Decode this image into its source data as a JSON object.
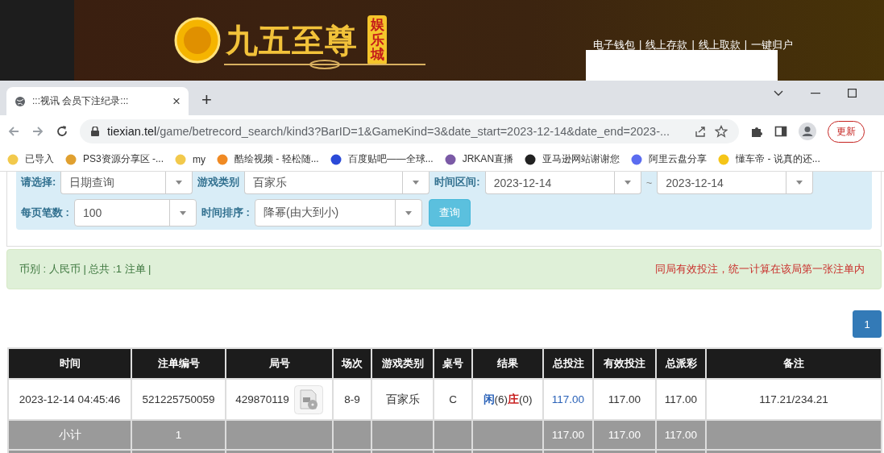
{
  "site_header": {
    "logo_text": "九五至尊",
    "logo_badge": "娱乐城",
    "nav_separator": "|",
    "nav": [
      "电子钱包",
      "线上存款",
      "线上取款",
      "一键归户"
    ]
  },
  "browser": {
    "tab_title": ":::视讯 会员下注纪录:::",
    "tab_close": "×",
    "new_tab": "+",
    "url_host": "tiexian.tel",
    "url_path": "/game/betrecord_search/kind3?BarID=1&GameKind=3&date_start=2023-12-14&date_end=2023-...",
    "update_button": "更新",
    "bookmarks": [
      {
        "label": "已导入",
        "color": "#f2c94c"
      },
      {
        "label": "PS3资源分享区 -...",
        "color": "#e0a030"
      },
      {
        "label": "my",
        "color": "#f2c94c"
      },
      {
        "label": "酷绘视频 - 轻松随...",
        "color": "#f08a24"
      },
      {
        "label": "百度贴吧——全球...",
        "color": "#2b4ad8"
      },
      {
        "label": "JRKAN直播",
        "color": "#7b5aa6"
      },
      {
        "label": "亚马逊网站谢谢您",
        "color": "#222222"
      },
      {
        "label": "阿里云盘分享",
        "color": "#5b6cf0"
      },
      {
        "label": "懂车帝 - 说真的还...",
        "color": "#f5c518"
      }
    ]
  },
  "filters": {
    "row1": [
      {
        "label": "请选择:",
        "value": "日期查询"
      },
      {
        "label": "游戏类别",
        "value": "百家乐"
      }
    ],
    "range": {
      "label": "时间区间:",
      "from": "2023-12-14",
      "sep": "~",
      "to": "2023-12-14"
    },
    "row2": [
      {
        "label": "每页笔数 :",
        "value": "100"
      },
      {
        "label": "时间排序 :",
        "value": "降幂(由大到小)"
      }
    ],
    "search_button": "查询"
  },
  "summary": {
    "text": "币别 : 人民币 | 总共 :1 注单 |",
    "notice": "同局有效投注，统一计算在该局第一张注单内"
  },
  "pagination": [
    {
      "label": "1",
      "selected": true
    }
  ],
  "table": {
    "columns": [
      "时间",
      "注单编号",
      "局号",
      "场次",
      "游戏类别",
      "桌号",
      "结果",
      "总投注",
      "有效投注",
      "总派彩",
      "备注"
    ],
    "rows": [
      {
        "kind": "data",
        "cells": [
          {
            "text": "2023-12-14 04:45:46"
          },
          {
            "text": "521225750059"
          },
          {
            "text": "429870119",
            "kind": "video"
          },
          {
            "text": "8-9"
          },
          {
            "text": "百家乐"
          },
          {
            "text": "C"
          },
          {
            "kind": "result",
            "parts": [
              {
                "side": "闲",
                "score": "(6)",
                "color": "#2a62b8"
              },
              {
                "side": "庄",
                "score": "(0)",
                "color": "#c82020"
              }
            ]
          },
          {
            "text": "117.00",
            "kind": "link"
          },
          {
            "text": "117.00"
          },
          {
            "text": "117.00"
          },
          {
            "text": "117.21/234.21"
          }
        ]
      },
      {
        "kind": "subtotal",
        "cells": [
          {
            "text": "小计"
          },
          {
            "text": "1"
          },
          {},
          {},
          {},
          {},
          {},
          {
            "text": "117.00"
          },
          {
            "text": "117.00"
          },
          {
            "text": "117.00"
          },
          {}
        ]
      },
      {
        "kind": "subtotal",
        "cells": [
          {},
          {},
          {},
          {},
          {},
          {},
          {},
          {},
          {},
          {},
          {}
        ]
      }
    ]
  }
}
